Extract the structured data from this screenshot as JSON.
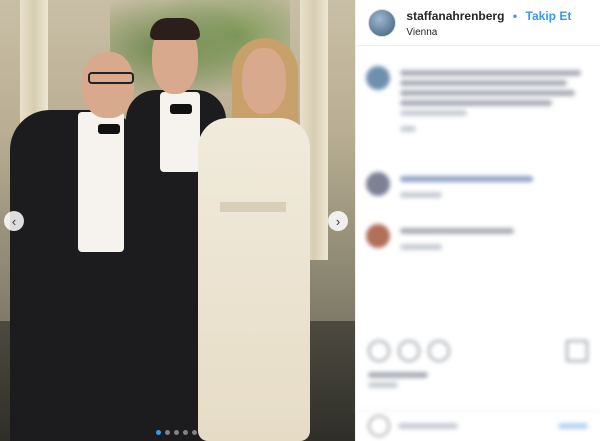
{
  "post": {
    "username": "staffanahrenberg",
    "separator": "•",
    "follow_label": "Takip Et",
    "location": "Vienna",
    "carousel_prev_glyph": "‹",
    "carousel_next_glyph": "›"
  },
  "icons": {
    "prev": "chevron-left-icon",
    "next": "chevron-right-icon",
    "like": "heart-icon",
    "comment": "comment-icon",
    "share": "share-icon",
    "save": "bookmark-icon"
  },
  "colors": {
    "accent": "#3897f0",
    "text": "#262626"
  }
}
